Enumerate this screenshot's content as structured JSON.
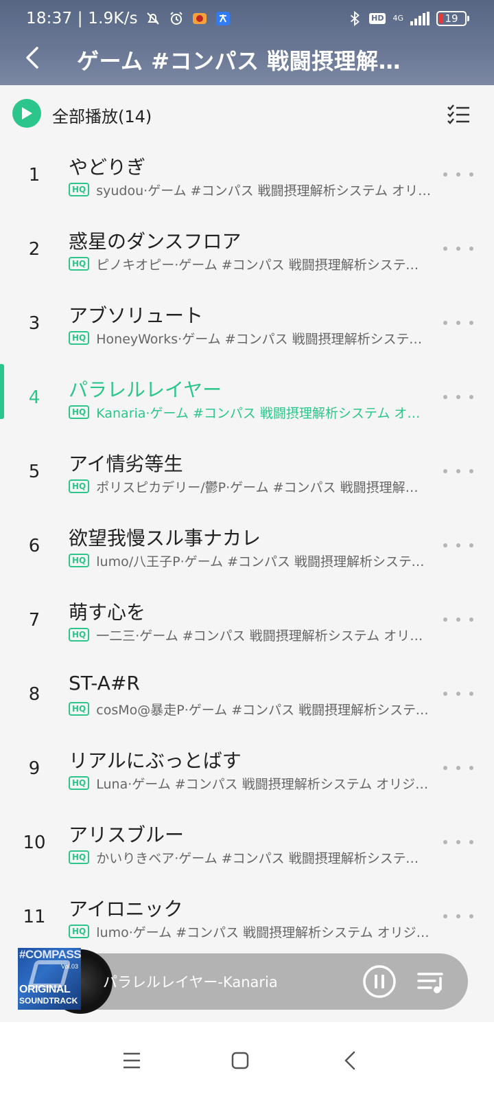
{
  "status_bar": {
    "time_speed": "18:37 | 1.9K/s",
    "network_label": "4G",
    "hd_label": "HD",
    "battery": "19"
  },
  "header": {
    "title": "ゲーム #コンパス 戦闘摂理解析システム オリジナルサウンドトラック"
  },
  "play_all": {
    "label": "全部播放(14)"
  },
  "hq_label": "HQ",
  "tracks": [
    {
      "num": "1",
      "title": "やどりぎ",
      "meta": "syudou·ゲーム #コンパス 戦闘摂理解析システム オリジナルサウンドトラック"
    },
    {
      "num": "2",
      "title": "惑星のダンスフロア",
      "meta": "ピノキオピー·ゲーム #コンパス 戦闘摂理解析システム オリジナルサウンドトラック"
    },
    {
      "num": "3",
      "title": "アブソリュート",
      "meta": "HoneyWorks·ゲーム #コンパス 戦闘摂理解析システム オリジナルサウンドトラック"
    },
    {
      "num": "4",
      "title": "パラレルレイヤー",
      "meta": "Kanaria·ゲーム #コンパス 戦闘摂理解析システム オリジナルサウンドトラック"
    },
    {
      "num": "5",
      "title": "アイ情劣等生",
      "meta": "ポリスピカデリー/鬱P·ゲーム #コンパス 戦闘摂理解析システム オリジナルサウンドトラック"
    },
    {
      "num": "6",
      "title": "欲望我慢スル事ナカレ",
      "meta": "lumo/八王子P·ゲーム #コンパス 戦闘摂理解析システム オリジナルサウンドトラック"
    },
    {
      "num": "7",
      "title": "萌す心を",
      "meta": "一二三·ゲーム #コンパス 戦闘摂理解析システム オリジナルサウンドトラック"
    },
    {
      "num": "8",
      "title": "ST-A#R",
      "meta": "cosMo@暴走P·ゲーム #コンパス 戦闘摂理解析システム オリジナルサウンドトラック"
    },
    {
      "num": "9",
      "title": "リアルにぶっとばす",
      "meta": "Luna·ゲーム #コンパス 戦闘摂理解析システム オリジナルサウンドトラック"
    },
    {
      "num": "10",
      "title": "アリスブルー",
      "meta": "かいりきベア·ゲーム #コンパス 戦闘摂理解析システム オリジナルサウンドトラック"
    },
    {
      "num": "11",
      "title": "アイロニック",
      "meta": "lumo·ゲーム #コンパス 戦闘摂理解析システム オリジナルサウンドトラック"
    }
  ],
  "active_track_index": 3,
  "mini_player": {
    "now_playing": "パラレルレイヤー-Kanaria",
    "cover_text_top": "#COMPASS",
    "cover_text_mid": "ORIGINAL",
    "cover_text_bottom": "SOUNDTRACK",
    "cover_vol": "Vol.03"
  },
  "colors": {
    "accent": "#2cc58b",
    "header": "#5d6c88"
  }
}
